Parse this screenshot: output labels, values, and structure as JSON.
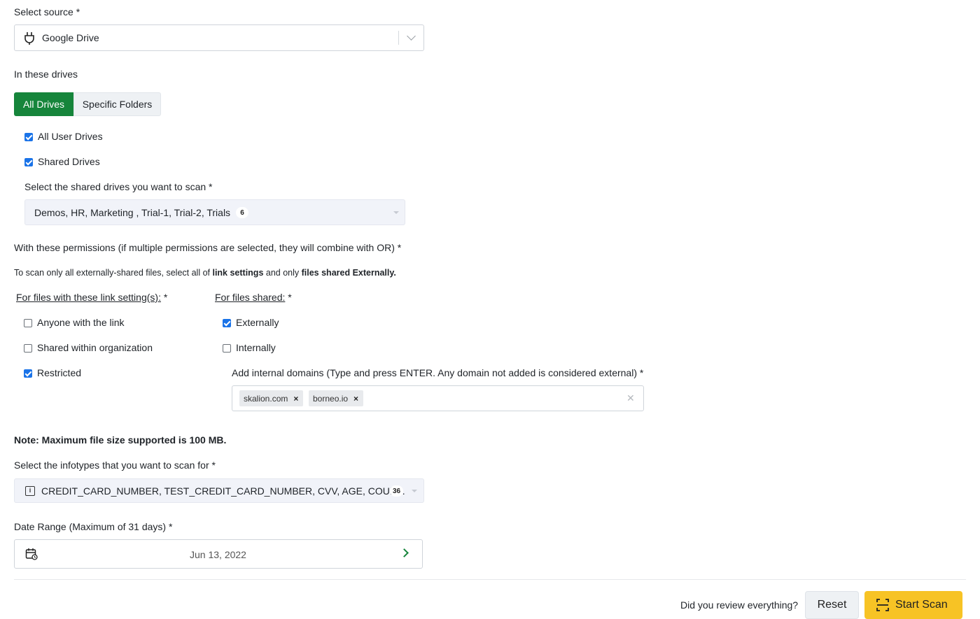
{
  "source": {
    "label": "Select source",
    "value": "Google Drive",
    "icon": "plug-icon"
  },
  "drives": {
    "label": "In these drives",
    "tabs": [
      "All Drives",
      "Specific Folders"
    ],
    "active_tab": "All Drives",
    "options": [
      {
        "label": "All User Drives",
        "checked": true
      },
      {
        "label": "Shared Drives",
        "checked": true
      }
    ],
    "shared_select_label": "Select the shared drives you want to scan",
    "shared_select_value": "Demos, HR, Marketing , Trial-1, Trial-2, Trials",
    "shared_select_count": "6"
  },
  "permissions": {
    "label": "With these permissions (if multiple permissions are selected, they will combine with OR)",
    "hint_prefix": "To scan only all externally-shared files, select all of ",
    "hint_bold1": "link settings",
    "hint_middle": " and only ",
    "hint_bold2": "files shared Externally.",
    "link_settings_label": "For files with these link setting(s):",
    "link_settings": [
      {
        "label": "Anyone with the link",
        "checked": false
      },
      {
        "label": "Shared within organization",
        "checked": false
      },
      {
        "label": "Restricted",
        "checked": true
      }
    ],
    "shared_label": "For files shared:",
    "shared": [
      {
        "label": "Externally",
        "checked": true
      },
      {
        "label": "Internally",
        "checked": false
      }
    ],
    "domains_label": "Add internal domains (Type and press ENTER. Any domain not added is considered external)",
    "domains": [
      "skalion.com",
      "borneo.io"
    ]
  },
  "note": "Note: Maximum file size supported is 100 MB.",
  "infotypes": {
    "label": "Select the infotypes that you want to scan for",
    "value": "CREDIT_CARD_NUMBER, TEST_CREDIT_CARD_NUMBER, CVV, AGE, COUN...",
    "count": "36"
  },
  "date_range": {
    "label": "Date Range (Maximum of 31 days)",
    "value": "Jun 13, 2022"
  },
  "footer": {
    "question": "Did you review everything?",
    "reset_label": "Reset",
    "start_label": "Start Scan"
  },
  "colors": {
    "accent_green": "#16853b",
    "checkbox_blue": "#1a73e8",
    "start_button": "#f7c325"
  }
}
